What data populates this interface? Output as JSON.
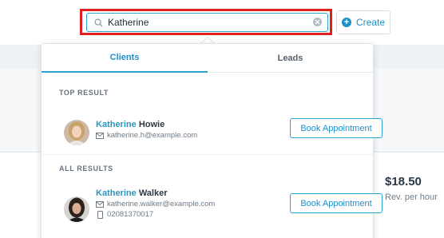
{
  "search": {
    "value": "Katherine"
  },
  "create_label": "Create",
  "tabs": [
    {
      "label": "Clients",
      "active": true
    },
    {
      "label": "Leads",
      "active": false
    }
  ],
  "sections": {
    "top": "TOP RESULT",
    "all": "ALL RESULTS"
  },
  "results": [
    {
      "first": "Katherine",
      "last": "Howie",
      "email": "katherine.h@example.com",
      "button": "Book Appointment"
    },
    {
      "first": "Katherine",
      "last": "Walker",
      "email": "katherine.walker@example.com",
      "phone": "02081370017",
      "button": "Book Appointment"
    }
  ],
  "background": {
    "rev_value": "$18.50",
    "rev_label": "Rev. per hour"
  },
  "colors": {
    "accent": "#2aa3d0",
    "highlight_border": "#e0201f"
  }
}
